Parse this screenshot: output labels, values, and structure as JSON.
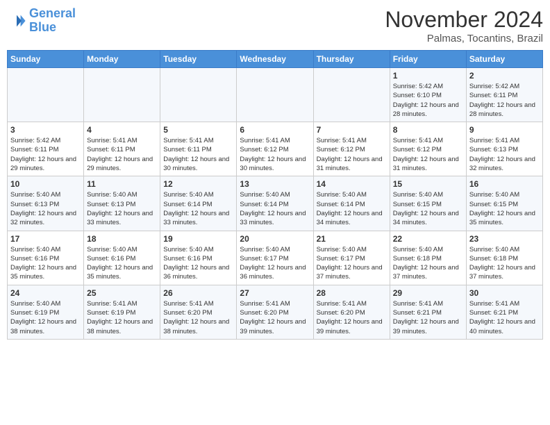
{
  "header": {
    "logo_line1": "General",
    "logo_line2": "Blue",
    "month": "November 2024",
    "location": "Palmas, Tocantins, Brazil"
  },
  "weekdays": [
    "Sunday",
    "Monday",
    "Tuesday",
    "Wednesday",
    "Thursday",
    "Friday",
    "Saturday"
  ],
  "weeks": [
    [
      {
        "day": "",
        "info": ""
      },
      {
        "day": "",
        "info": ""
      },
      {
        "day": "",
        "info": ""
      },
      {
        "day": "",
        "info": ""
      },
      {
        "day": "",
        "info": ""
      },
      {
        "day": "1",
        "info": "Sunrise: 5:42 AM\nSunset: 6:10 PM\nDaylight: 12 hours and 28 minutes."
      },
      {
        "day": "2",
        "info": "Sunrise: 5:42 AM\nSunset: 6:11 PM\nDaylight: 12 hours and 28 minutes."
      }
    ],
    [
      {
        "day": "3",
        "info": "Sunrise: 5:42 AM\nSunset: 6:11 PM\nDaylight: 12 hours and 29 minutes."
      },
      {
        "day": "4",
        "info": "Sunrise: 5:41 AM\nSunset: 6:11 PM\nDaylight: 12 hours and 29 minutes."
      },
      {
        "day": "5",
        "info": "Sunrise: 5:41 AM\nSunset: 6:11 PM\nDaylight: 12 hours and 30 minutes."
      },
      {
        "day": "6",
        "info": "Sunrise: 5:41 AM\nSunset: 6:12 PM\nDaylight: 12 hours and 30 minutes."
      },
      {
        "day": "7",
        "info": "Sunrise: 5:41 AM\nSunset: 6:12 PM\nDaylight: 12 hours and 31 minutes."
      },
      {
        "day": "8",
        "info": "Sunrise: 5:41 AM\nSunset: 6:12 PM\nDaylight: 12 hours and 31 minutes."
      },
      {
        "day": "9",
        "info": "Sunrise: 5:41 AM\nSunset: 6:13 PM\nDaylight: 12 hours and 32 minutes."
      }
    ],
    [
      {
        "day": "10",
        "info": "Sunrise: 5:40 AM\nSunset: 6:13 PM\nDaylight: 12 hours and 32 minutes."
      },
      {
        "day": "11",
        "info": "Sunrise: 5:40 AM\nSunset: 6:13 PM\nDaylight: 12 hours and 33 minutes."
      },
      {
        "day": "12",
        "info": "Sunrise: 5:40 AM\nSunset: 6:14 PM\nDaylight: 12 hours and 33 minutes."
      },
      {
        "day": "13",
        "info": "Sunrise: 5:40 AM\nSunset: 6:14 PM\nDaylight: 12 hours and 33 minutes."
      },
      {
        "day": "14",
        "info": "Sunrise: 5:40 AM\nSunset: 6:14 PM\nDaylight: 12 hours and 34 minutes."
      },
      {
        "day": "15",
        "info": "Sunrise: 5:40 AM\nSunset: 6:15 PM\nDaylight: 12 hours and 34 minutes."
      },
      {
        "day": "16",
        "info": "Sunrise: 5:40 AM\nSunset: 6:15 PM\nDaylight: 12 hours and 35 minutes."
      }
    ],
    [
      {
        "day": "17",
        "info": "Sunrise: 5:40 AM\nSunset: 6:16 PM\nDaylight: 12 hours and 35 minutes."
      },
      {
        "day": "18",
        "info": "Sunrise: 5:40 AM\nSunset: 6:16 PM\nDaylight: 12 hours and 35 minutes."
      },
      {
        "day": "19",
        "info": "Sunrise: 5:40 AM\nSunset: 6:16 PM\nDaylight: 12 hours and 36 minutes."
      },
      {
        "day": "20",
        "info": "Sunrise: 5:40 AM\nSunset: 6:17 PM\nDaylight: 12 hours and 36 minutes."
      },
      {
        "day": "21",
        "info": "Sunrise: 5:40 AM\nSunset: 6:17 PM\nDaylight: 12 hours and 37 minutes."
      },
      {
        "day": "22",
        "info": "Sunrise: 5:40 AM\nSunset: 6:18 PM\nDaylight: 12 hours and 37 minutes."
      },
      {
        "day": "23",
        "info": "Sunrise: 5:40 AM\nSunset: 6:18 PM\nDaylight: 12 hours and 37 minutes."
      }
    ],
    [
      {
        "day": "24",
        "info": "Sunrise: 5:40 AM\nSunset: 6:19 PM\nDaylight: 12 hours and 38 minutes."
      },
      {
        "day": "25",
        "info": "Sunrise: 5:41 AM\nSunset: 6:19 PM\nDaylight: 12 hours and 38 minutes."
      },
      {
        "day": "26",
        "info": "Sunrise: 5:41 AM\nSunset: 6:20 PM\nDaylight: 12 hours and 38 minutes."
      },
      {
        "day": "27",
        "info": "Sunrise: 5:41 AM\nSunset: 6:20 PM\nDaylight: 12 hours and 39 minutes."
      },
      {
        "day": "28",
        "info": "Sunrise: 5:41 AM\nSunset: 6:20 PM\nDaylight: 12 hours and 39 minutes."
      },
      {
        "day": "29",
        "info": "Sunrise: 5:41 AM\nSunset: 6:21 PM\nDaylight: 12 hours and 39 minutes."
      },
      {
        "day": "30",
        "info": "Sunrise: 5:41 AM\nSunset: 6:21 PM\nDaylight: 12 hours and 40 minutes."
      }
    ]
  ]
}
